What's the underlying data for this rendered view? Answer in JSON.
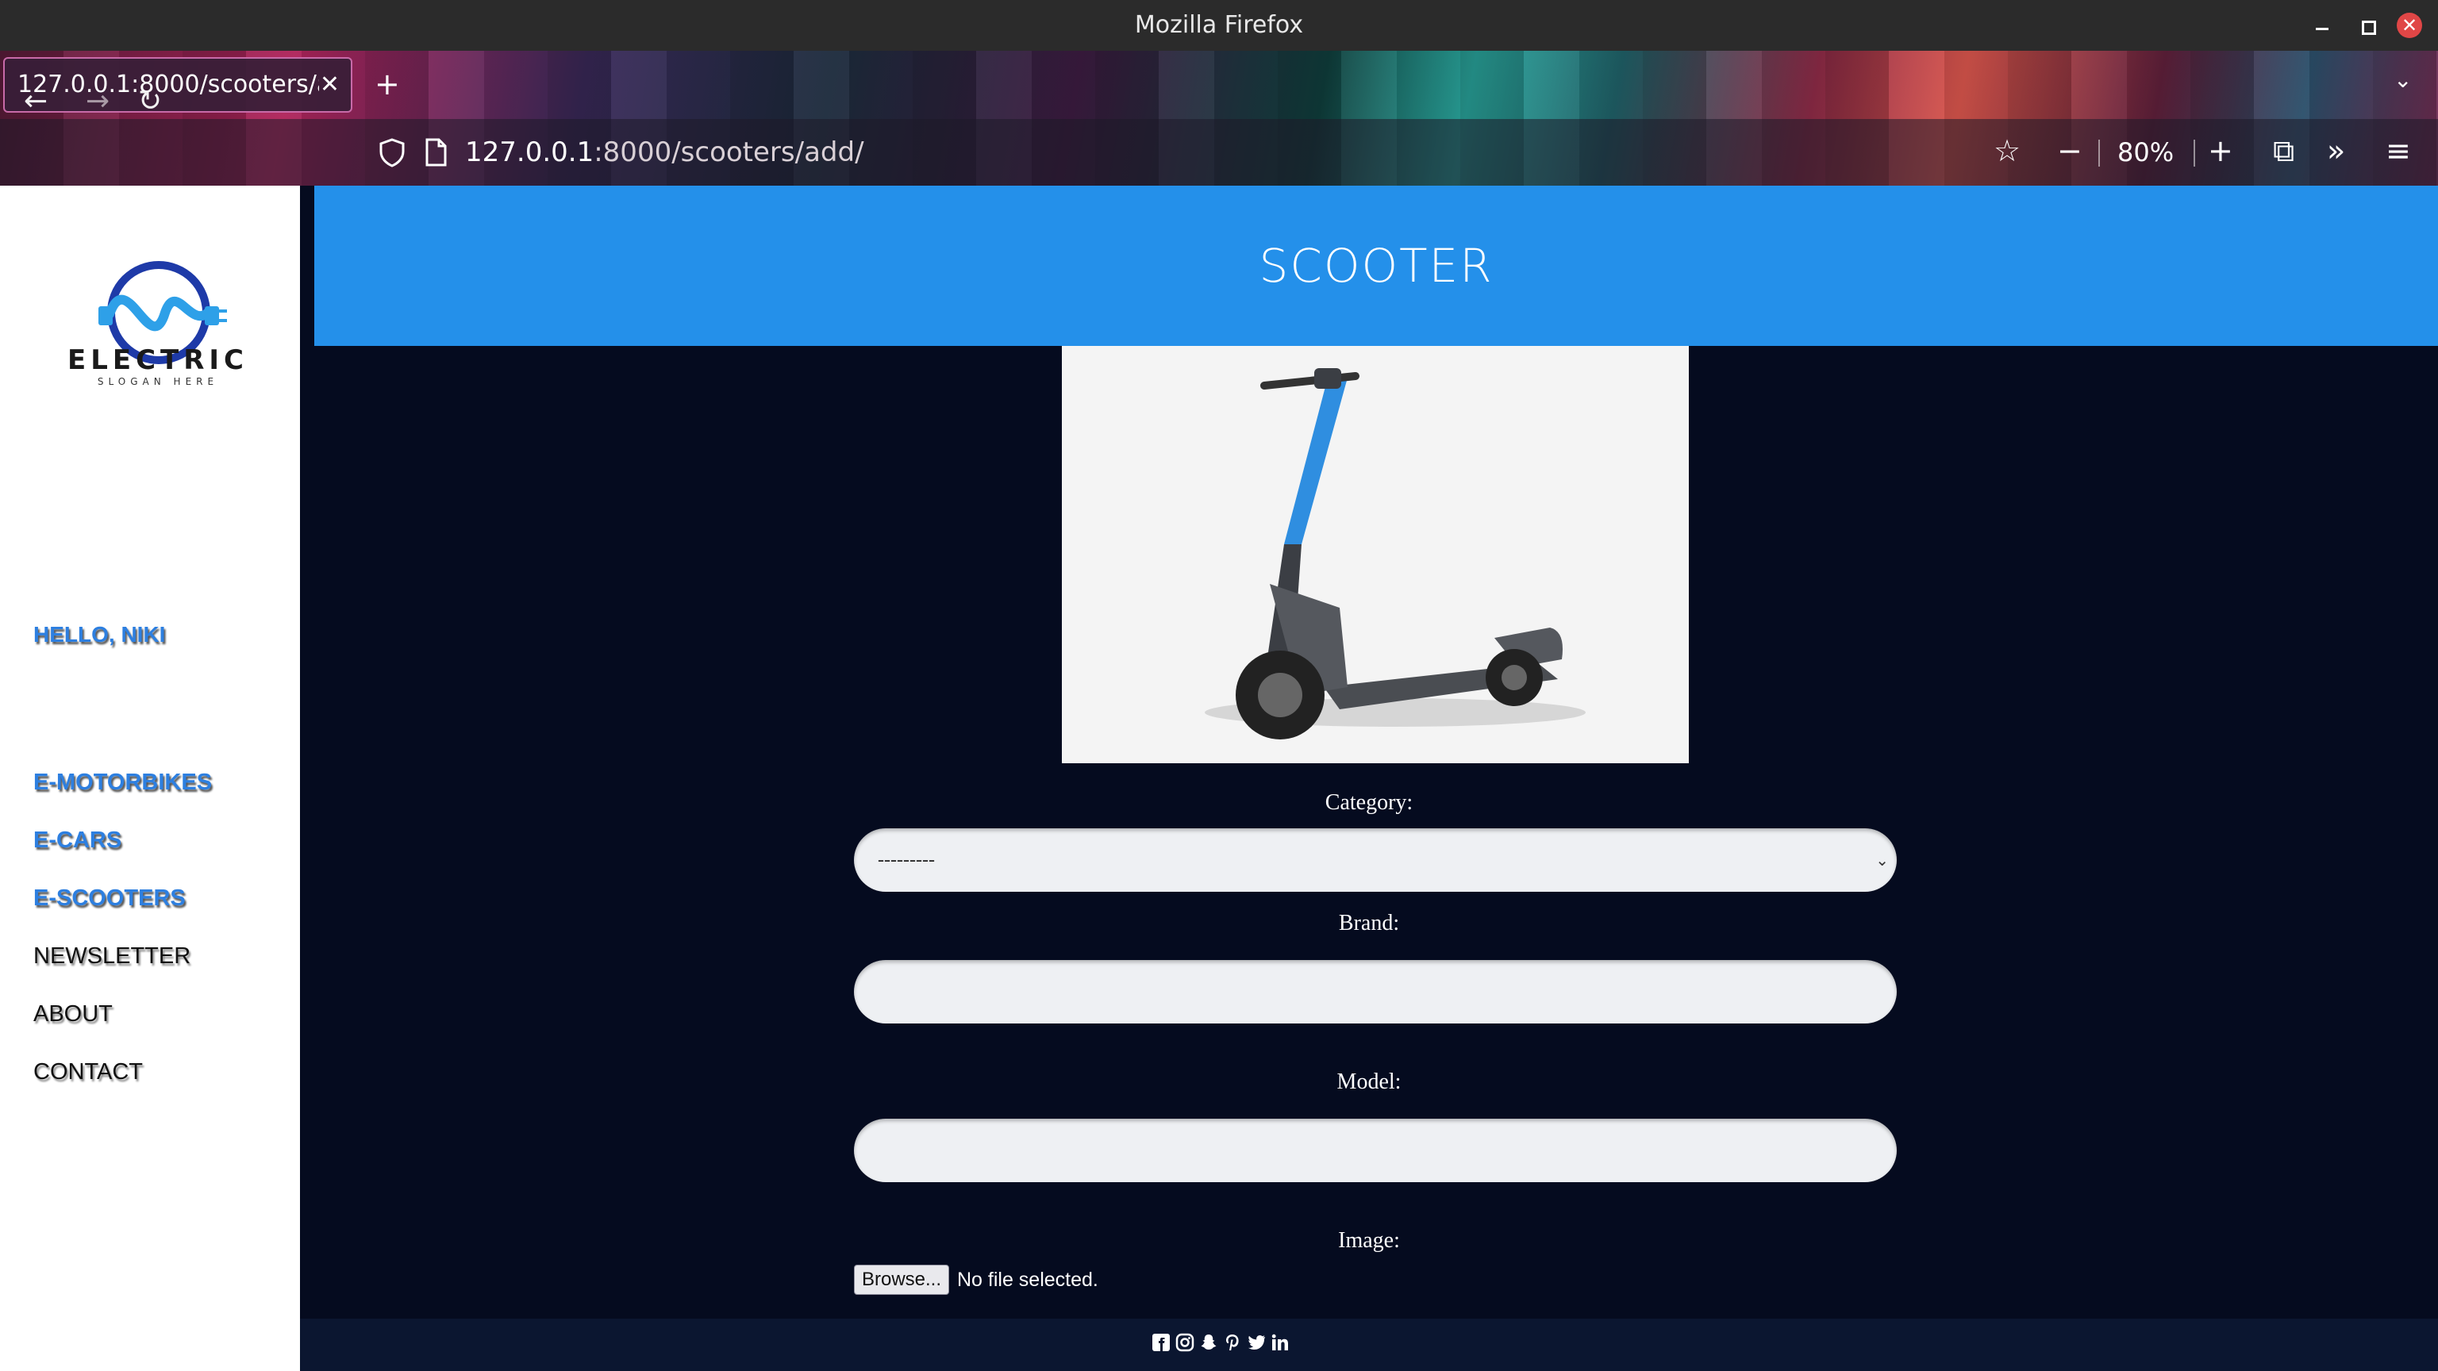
{
  "window": {
    "title": "Mozilla Firefox"
  },
  "browser": {
    "tab_title": "127.0.0.1:8000/scooters/add/",
    "url_host": "127.0.0.1",
    "url_rest": ":8000/scooters/add/",
    "zoom": "80%"
  },
  "sidebar": {
    "logo_text": "ELECTRIC",
    "logo_slogan": "SLOGAN HERE",
    "greeting": "HELLO, NIKI",
    "nav": [
      "E-MOTORBIKES",
      "E-CARS",
      "E-SCOOTERS",
      "NEWSLETTER",
      "ABOUT",
      "CONTACT"
    ]
  },
  "header": {
    "title": "SCOOTER"
  },
  "form": {
    "category_label": "Category:",
    "category_value": "---------",
    "brand_label": "Brand:",
    "brand_value": "",
    "model_label": "Model:",
    "model_value": "",
    "image_label": "Image:",
    "browse_label": "Browse...",
    "file_status": "No file selected."
  },
  "colors": {
    "accent": "#2490ea",
    "page_bg": "#050b1f",
    "sidebar_bg": "#ffffff"
  },
  "footer": {
    "icons": [
      "facebook-icon",
      "instagram-icon",
      "snapchat-icon",
      "pinterest-icon",
      "twitter-icon",
      "linkedin-icon"
    ]
  }
}
